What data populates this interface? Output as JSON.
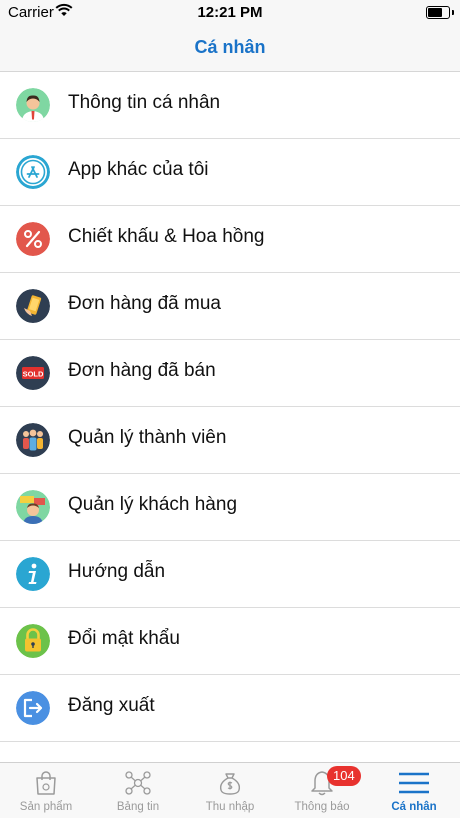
{
  "status_bar": {
    "carrier": "Carrier",
    "time": "12:21 PM"
  },
  "nav": {
    "title": "Cá nhân"
  },
  "menu": [
    {
      "label": "Thông tin cá nhân",
      "icon": "user-profile-icon"
    },
    {
      "label": "App khác của tôi",
      "icon": "app-store-icon"
    },
    {
      "label": "Chiết khấu & Hoa hồng",
      "icon": "percent-icon"
    },
    {
      "label": "Đơn hàng đã mua",
      "icon": "phone-order-icon"
    },
    {
      "label": "Đơn hàng đã bán",
      "icon": "sold-icon"
    },
    {
      "label": "Quản lý thành viên",
      "icon": "members-icon"
    },
    {
      "label": "Quản lý khách hàng",
      "icon": "customers-icon"
    },
    {
      "label": "Hướng dẫn",
      "icon": "info-icon"
    },
    {
      "label": "Đổi mật khẩu",
      "icon": "lock-icon"
    },
    {
      "label": "Đăng xuất",
      "icon": "logout-icon"
    }
  ],
  "sold_icon_text": "SOLD",
  "tabs": [
    {
      "label": "Sản phẩm"
    },
    {
      "label": "Bảng tin"
    },
    {
      "label": "Thu nhập"
    },
    {
      "label": "Thông báo",
      "badge": "104"
    },
    {
      "label": "Cá nhân"
    }
  ],
  "colors": {
    "accent": "#1a73c8",
    "badge": "#e8322e",
    "inactive": "#9a9a9a"
  }
}
